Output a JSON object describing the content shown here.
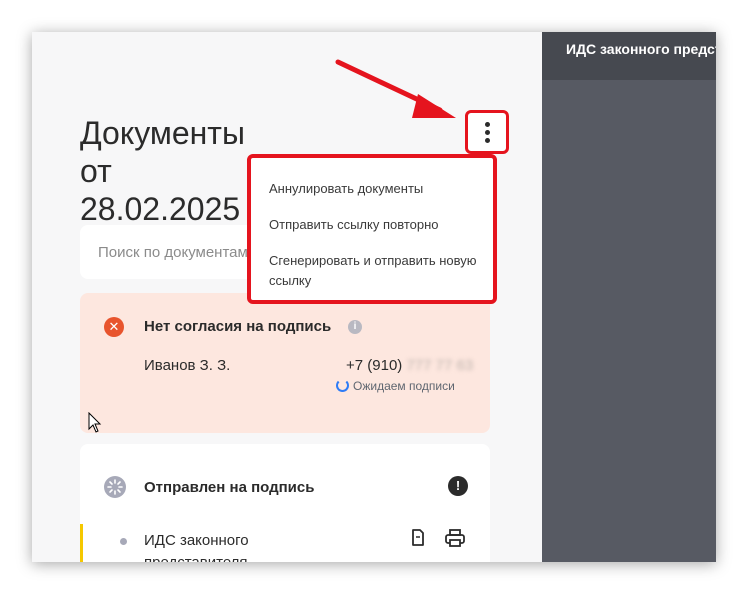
{
  "header": {
    "right_title": "ИДС законного представителя"
  },
  "page": {
    "title": "Документы от 28.02.2025"
  },
  "search": {
    "placeholder": "Поиск по документам"
  },
  "error_card": {
    "title": "Нет согласия на подпись",
    "signer_name": "Иванов З. З.",
    "phone_visible": "+7 (910)",
    "phone_hidden": "777 77 63",
    "status": "Ожидаем подписи"
  },
  "sent_card": {
    "title": "Отправлен на подпись",
    "doc_name": "ИДС законного представителя"
  },
  "menu": {
    "items": [
      "Аннулировать документы",
      "Отправить ссылку повторно",
      "Сгенерировать и отправить новую ссылку"
    ]
  },
  "colors": {
    "accent_red": "#e5141e",
    "error_bg": "#fde7df",
    "error_icon": "#e8542d",
    "right_panel": "#575a63",
    "yellow_bar": "#f5c800"
  }
}
